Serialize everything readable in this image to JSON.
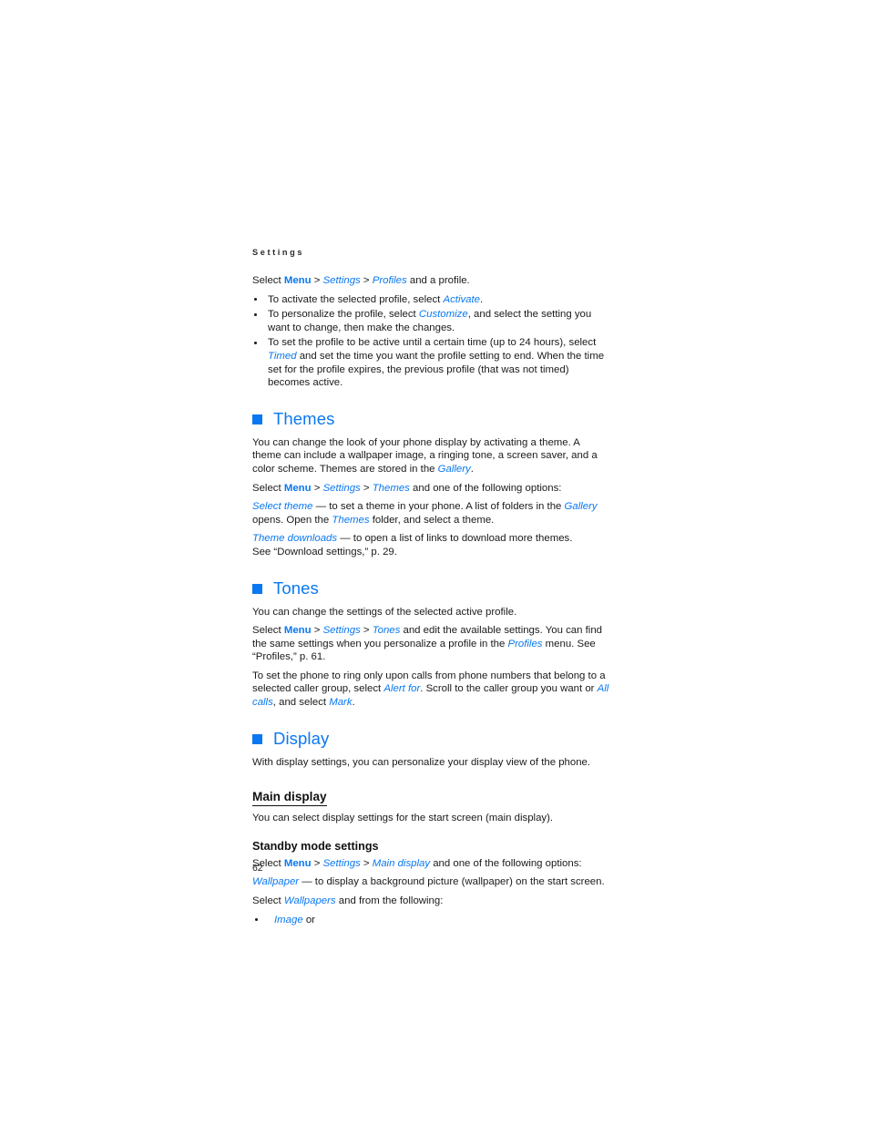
{
  "page": {
    "running_header": "Settings",
    "folio": "62",
    "accent_blue": "#0a78f0",
    "body_color": "#1a1a1a"
  },
  "profiles_block": {
    "select_line": {
      "lead": "Select ",
      "menu": "Menu",
      "sep1": " > ",
      "item1": "Settings",
      "sep2": " > ",
      "item2": "Profiles",
      "tail": " and a profile."
    },
    "bullets": [
      {
        "pre": "To activate the selected profile, select ",
        "ui": "Activate",
        "post": "."
      },
      {
        "pre": "To personalize the profile, select ",
        "ui": "Customize",
        "post": ", and select the setting you want to change, then make the changes."
      },
      {
        "pre": "To set the profile to be active until a certain time (up to 24 hours), select ",
        "ui": "Timed",
        "post": " and set the time you want the profile setting to end. When the time set for the profile expires, the previous profile (that was not timed) becomes active."
      }
    ]
  },
  "themes": {
    "heading": "Themes",
    "intro_pre": "You can change the look of your phone display by activating a theme. A theme can include a wallpaper image, a ringing tone, a screen saver, and a color scheme. Themes are stored in the ",
    "intro_ui": "Gallery",
    "intro_post": ".",
    "select_line": {
      "lead": "Select ",
      "menu": "Menu",
      "sep1": " > ",
      "item1": "Settings",
      "sep2": " > ",
      "item2": "Themes",
      "tail": " and one of the following options:"
    },
    "select_theme": {
      "ui": "Select theme",
      "mid": " — to set a theme in your phone. A list of folders in the ",
      "ui2": "Gallery",
      "mid2": " opens. Open the ",
      "ui3": "Themes",
      "tail": " folder, and select a theme."
    },
    "theme_downloads": {
      "ui": "Theme downloads",
      "tail": " — to open a list of links to download more themes.",
      "see_line": "See “Download settings,” p. 29."
    }
  },
  "tones": {
    "heading": "Tones",
    "intro": "You can change the settings of the selected active profile.",
    "select_line": {
      "lead": "Select ",
      "menu": "Menu",
      "sep1": " > ",
      "item1": "Settings",
      "sep2": " > ",
      "item2": "Tones",
      "mid": " and edit the available settings. You can find the same settings when you personalize a profile in the ",
      "item3": "Profiles",
      "tail": " menu. See “Profiles,” p. 61."
    },
    "alert_para": {
      "pre": "To set the phone to ring only upon calls from phone numbers that belong to a selected caller group, select ",
      "ui1": "Alert for",
      "mid1": ". Scroll to the caller group you want or ",
      "ui2": "All calls",
      "mid2": ", and select ",
      "ui3": "Mark",
      "post": "."
    }
  },
  "display": {
    "heading": "Display",
    "intro": "With display settings, you can personalize your display view of the phone.",
    "main_display": {
      "heading": "Main display",
      "intro": "You can select display settings for the start screen (main display)."
    },
    "standby": {
      "heading": "Standby mode settings",
      "select_line": {
        "lead": "Select ",
        "menu": "Menu",
        "sep1": " > ",
        "item1": "Settings",
        "sep2": " > ",
        "item2": "Main display",
        "tail": " and one of the following options:"
      },
      "wallpaper_line": {
        "ui": "Wallpaper",
        "tail": " — to display a background picture (wallpaper) on the start screen."
      },
      "select_wallpapers": {
        "lead": "Select ",
        "ui": "Wallpapers",
        "tail": " and from the following:"
      },
      "bullets": [
        {
          "ui": "Image",
          "post": " or"
        }
      ]
    }
  }
}
